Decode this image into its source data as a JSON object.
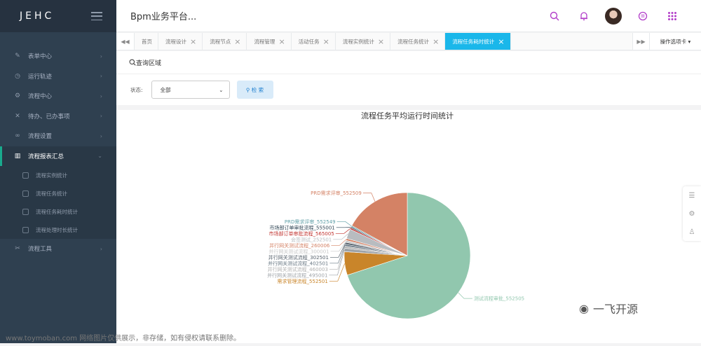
{
  "app": {
    "logo": "JEHC",
    "title": "Bpm业务平台..."
  },
  "sidebar": {
    "items": [
      {
        "label": "表单中心",
        "icon": "pencil-icon"
      },
      {
        "label": "运行轨迹",
        "icon": "clock-icon"
      },
      {
        "label": "流程中心",
        "icon": "gear-icon"
      },
      {
        "label": "待办、已办事项",
        "icon": "mute-icon"
      },
      {
        "label": "流程设置",
        "icon": "link-icon"
      },
      {
        "label": "流程报表汇总",
        "icon": "bar-chart-icon",
        "active": true
      },
      {
        "label": "流程工具",
        "icon": "tools-icon"
      }
    ],
    "subitems": [
      "流程实例统计",
      "流程任务统计",
      "流程任务耗时统计",
      "流程处理时长统计"
    ]
  },
  "tabs": {
    "items": [
      "首页",
      "流程设计",
      "流程节点",
      "流程管理",
      "活动任务",
      "流程实例统计",
      "流程任务统计",
      "流程任务耗时统计"
    ],
    "active_index": 7,
    "ops_label": "操作选项卡"
  },
  "query": {
    "header": "查询区域",
    "status_label": "状态:",
    "status_value": "全部",
    "search_label": "检 索"
  },
  "chart_data": {
    "type": "pie",
    "title": "流程任务平均运行时间统计",
    "slices": [
      {
        "label": "测试流程审批_552505",
        "value": 70,
        "color": "#91c7ae"
      },
      {
        "label": "需求管理流程_552501",
        "value": 6.0,
        "color": "#c9852a"
      },
      {
        "label": "并行网关测试流程_495001",
        "value": 0.9,
        "color": "#9ea3a8"
      },
      {
        "label": "并行网关测试流程_460003",
        "value": 0.5,
        "color": "#b0b0b0"
      },
      {
        "label": "并行网关测试流程_402501",
        "value": 0.5,
        "color": "#6a7985"
      },
      {
        "label": "并行网关测试流程_302501",
        "value": 0.5,
        "color": "#55606b"
      },
      {
        "label": "并行网关测试流程_300001",
        "value": 0.5,
        "color": "#c8c8c8"
      },
      {
        "label": "并行网关测试流程_260006",
        "value": 0.5,
        "color": "#d48265"
      },
      {
        "label": "会签测试_252501",
        "value": 2.5,
        "color": "#b8bcc0"
      },
      {
        "label": "市场部订单审批流程_565005",
        "value": 0.4,
        "color": "#c23531"
      },
      {
        "label": "市场部订单审批流程_555001",
        "value": 0.3,
        "color": "#2f4554"
      },
      {
        "label": "PRD需求评审_552549",
        "value": 0.3,
        "color": "#61a0a8"
      },
      {
        "label": "PRD需求评审_552509",
        "value": 17.1,
        "color": "#d48265"
      }
    ]
  },
  "watermark": {
    "text": "一飞开源"
  },
  "footer": {
    "text": "www.toymoban.com 网络图片仅供展示，非存储，如有侵权请联系删除。"
  }
}
